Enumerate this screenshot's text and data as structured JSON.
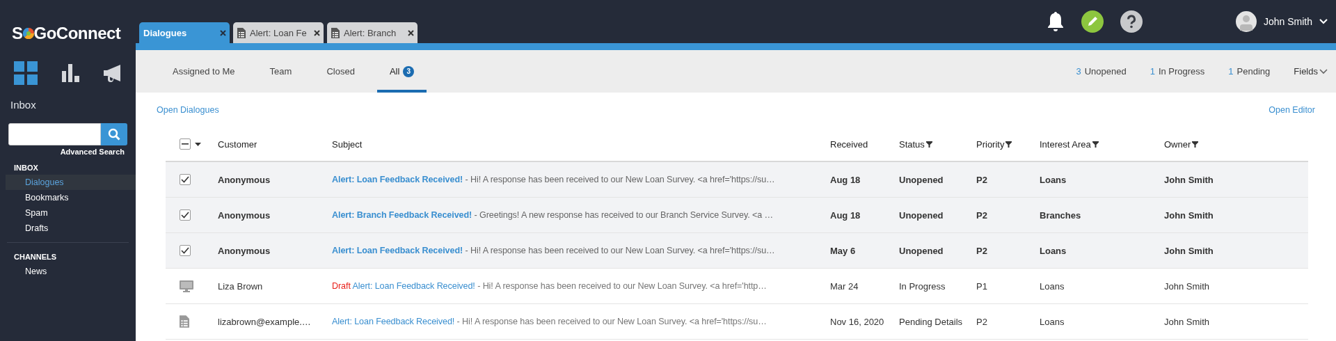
{
  "sidebar": {
    "logo": {
      "before": "S",
      "after": "GoConnect"
    },
    "nav_icons": [
      {
        "kind": "dashboard",
        "selected": true
      },
      {
        "kind": "reports",
        "selected": false
      },
      {
        "kind": "campaigns",
        "selected": false
      }
    ],
    "section_title": "Inbox",
    "advanced_search": "Advanced Search",
    "groups": [
      {
        "title": "INBOX",
        "items": [
          {
            "label": "Dialogues",
            "selected": true
          },
          {
            "label": "Bookmarks",
            "selected": false
          },
          {
            "label": "Spam",
            "selected": false
          },
          {
            "label": "Drafts",
            "selected": false
          }
        ]
      },
      {
        "title": "CHANNELS",
        "items": [
          {
            "label": "News",
            "selected": false
          }
        ]
      }
    ]
  },
  "topbar": {
    "tabs": [
      {
        "label": "Dialogues",
        "kind": "list",
        "selected": true
      },
      {
        "label": "Alert: Loan Fe",
        "kind": "document",
        "selected": false
      },
      {
        "label": "Alert: Branch",
        "kind": "document",
        "selected": false
      }
    ],
    "user": {
      "name": "John Smith"
    }
  },
  "subnav": {
    "tabs": [
      {
        "label": "Assigned to Me",
        "selected": false
      },
      {
        "label": "Team",
        "selected": false
      },
      {
        "label": "Closed",
        "selected": false
      },
      {
        "label": "All",
        "badge": "3",
        "selected": true
      }
    ],
    "stats": [
      {
        "count": "3",
        "label": "Unopened"
      },
      {
        "count": "1",
        "label": "In Progress"
      },
      {
        "count": "1",
        "label": "Pending"
      }
    ],
    "fields": "Fields"
  },
  "actions": {
    "left": "Open Dialogues",
    "right": "Open Editor"
  },
  "table": {
    "select_all": {
      "indeterminate": true
    },
    "columns": [
      {
        "label": "Customer",
        "filter": false
      },
      {
        "label": "Subject",
        "filter": false
      },
      {
        "label": "Received",
        "filter": false
      },
      {
        "label": "Status",
        "filter": true
      },
      {
        "label": "Priority",
        "filter": true
      },
      {
        "label": "Interest Area",
        "filter": true
      },
      {
        "label": "Owner",
        "filter": true
      }
    ],
    "rows": [
      {
        "kind": "checkbox",
        "checked": true,
        "unread": true,
        "customer": "Anonymous",
        "subject": "Alert: Loan Feedback Received!",
        "preview": "- Hi! A response has been received to our New Loan Survey. <a href='https://su…",
        "received": "Aug 18",
        "status": "Unopened",
        "priority": "P2",
        "interest_area": "Loans",
        "owner": "John Smith"
      },
      {
        "kind": "checkbox",
        "checked": true,
        "unread": true,
        "customer": "Anonymous",
        "subject": "Alert: Branch Feedback Received!",
        "preview": "- Greetings! A new response has received to our Branch Service Survey. <a …",
        "received": "Aug 18",
        "status": "Unopened",
        "priority": "P2",
        "interest_area": "Branches",
        "owner": "John Smith"
      },
      {
        "kind": "checkbox",
        "checked": true,
        "unread": true,
        "customer": "Anonymous",
        "subject": "Alert: Loan Feedback Received!",
        "preview": "- Hi! A response has been received to our New Loan Survey. <a href='https://su…",
        "received": "May 6",
        "status": "Unopened",
        "priority": "P2",
        "interest_area": "Loans",
        "owner": "John Smith"
      },
      {
        "kind": "monitor",
        "unread": false,
        "customer": "Liza Brown",
        "draft": "Draft",
        "subject": "Alert: Loan Feedback Received!",
        "preview": "- Hi! A response has been received to our New Loan Survey. <a href='http…",
        "received": "Mar 24",
        "status": "In Progress",
        "priority": "P1",
        "interest_area": "Loans",
        "owner": "John Smith"
      },
      {
        "kind": "document",
        "unread": false,
        "customer": "lizabrown@example.…",
        "subject": "Alert: Loan Feedback Received!",
        "preview": "- Hi! A response has been received to our New Loan Survey. <a href='https://su…",
        "received": "Nov 16, 2020",
        "status": "Pending Details",
        "priority": "P2",
        "interest_area": "Loans",
        "owner": "John Smith"
      }
    ]
  }
}
